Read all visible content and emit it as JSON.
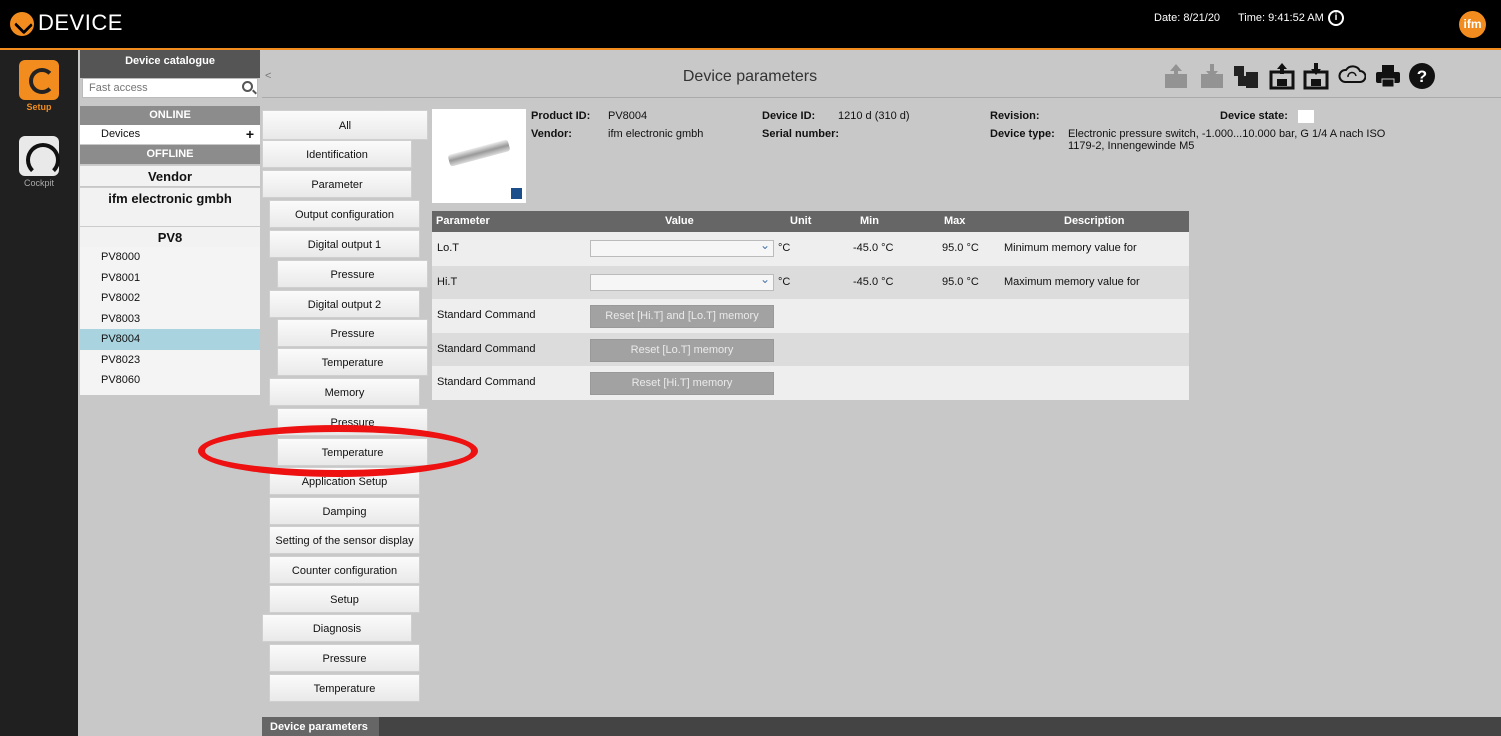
{
  "app": {
    "title": "DEVICE",
    "date": "Date: 8/21/20",
    "time": "Time: 9:41:52 AM",
    "brand_logo": "ifm"
  },
  "leftnav": {
    "items": [
      {
        "label": "Setup",
        "icon": "setup-icon",
        "active": true
      },
      {
        "label": "Cockpit",
        "icon": "cockpit-icon",
        "active": false
      }
    ]
  },
  "catalogue": {
    "header": "Device catalogue",
    "search_placeholder": "Fast access",
    "online_label": "ONLINE",
    "devices_label": "Devices",
    "offline_label": "OFFLINE",
    "vendor_label": "Vendor",
    "vendor_name": "ifm electronic gmbh",
    "family_label": "PV8",
    "devices": [
      "PV8000",
      "PV8001",
      "PV8002",
      "PV8003",
      "PV8004",
      "PV8023",
      "PV8060"
    ],
    "selected_device": "PV8004"
  },
  "content": {
    "collapse_glyph": "<",
    "page_title": "Device parameters",
    "toolbar_icons": [
      "upload-io-link-icon",
      "download-io-link-icon",
      "device-io-link-icon",
      "save-upload-icon",
      "save-download-icon",
      "sync-cloud-icon",
      "print-icon",
      "help-icon"
    ]
  },
  "tree": {
    "all": "All",
    "identification": "Identification",
    "parameter": "Parameter",
    "output_configuration": "Output configuration",
    "digital_output_1": "Digital output 1",
    "do1_pressure": "Pressure",
    "digital_output_2": "Digital output 2",
    "do2_pressure": "Pressure",
    "do2_temperature": "Temperature",
    "memory": "Memory",
    "mem_pressure": "Pressure",
    "mem_temperature": "Temperature",
    "application_setup": "Application Setup",
    "damping": "Damping",
    "sensor_display": "Setting of the sensor display",
    "counter_configuration": "Counter configuration",
    "setup": "Setup",
    "diagnosis": "Diagnosis",
    "diag_pressure": "Pressure",
    "diag_temperature": "Temperature"
  },
  "device_info": {
    "product_id_label": "Product ID:",
    "product_id": "PV8004",
    "vendor_label": "Vendor:",
    "vendor": "ifm electronic gmbh",
    "device_id_label": "Device ID:",
    "device_id": "1210 d (310 d)",
    "serial_label": "Serial number:",
    "serial": "",
    "revision_label": "Revision:",
    "revision": "",
    "device_type_label": "Device type:",
    "device_type_line1": "Electronic pressure switch, -1.000...10.000 bar, G 1/4 A nach ISO",
    "device_type_line2": "1179-2, Innengewinde M5",
    "device_state_label": "Device state:"
  },
  "table": {
    "headers": {
      "parameter": "Parameter",
      "value": "Value",
      "unit": "Unit",
      "min": "Min",
      "max": "Max",
      "description": "Description"
    },
    "rows": [
      {
        "parameter": "Lo.T",
        "value": "",
        "unit": "°C",
        "min": "-45.0 °C",
        "max": "95.0 °C",
        "description": "Minimum memory value for temperature"
      },
      {
        "parameter": "Hi.T",
        "value": "",
        "unit": "°C",
        "min": "-45.0 °C",
        "max": "95.0 °C",
        "description": "Maximum memory value for temperature"
      }
    ],
    "commands": [
      {
        "parameter": "Standard Command",
        "button": "Reset [Hi.T] and [Lo.T] memory"
      },
      {
        "parameter": "Standard Command",
        "button": "Reset [Lo.T] memory"
      },
      {
        "parameter": "Standard Command",
        "button": "Reset [Hi.T] memory"
      }
    ]
  },
  "footer": {
    "tab_label": "Device parameters"
  },
  "colors": {
    "accent": "#f28c1e",
    "highlight": "#ee1111",
    "selected_row": "#a9d3df"
  }
}
